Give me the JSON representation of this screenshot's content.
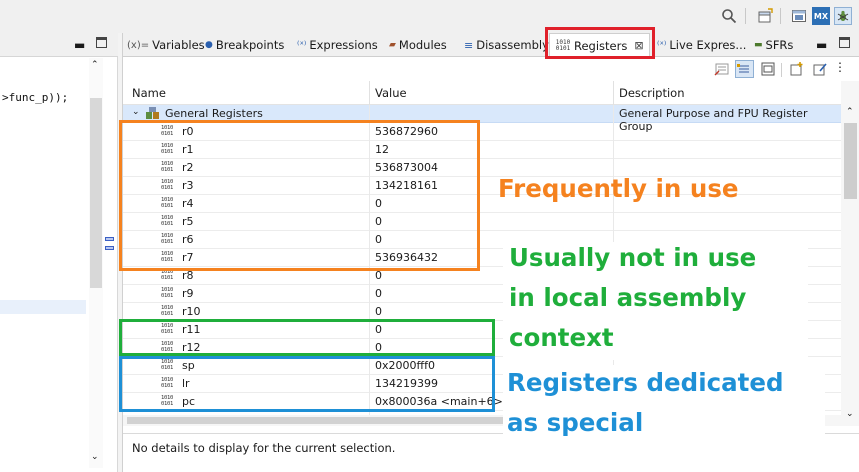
{
  "toolbar": {
    "search_icon": "search-icon",
    "icons": [
      "search-icon",
      "perspective-icon",
      "debug-perspective-icon",
      "mx-icon",
      "debug-icon"
    ],
    "mx_label": "MX"
  },
  "editor": {
    "code_line": ">func_p));"
  },
  "view_tabs": [
    {
      "label": "Variables",
      "icon": "(x)="
    },
    {
      "label": "Breakpoints",
      "icon": "●"
    },
    {
      "label": "Expressions",
      "icon": "⁽ˣ⁾"
    },
    {
      "label": "Modules",
      "icon": "▰"
    },
    {
      "label": "Disassembly",
      "icon": "≡"
    },
    {
      "label": "Registers",
      "icon": "1010"
    },
    {
      "label": "Live Expres...",
      "icon": "⁽ˣ⁾"
    },
    {
      "label": "SFRs",
      "icon": "▬"
    }
  ],
  "columns": {
    "name": "Name",
    "value": "Value",
    "description": "Description"
  },
  "group": {
    "name": "General Registers",
    "description": "General Purpose and FPU Register Group"
  },
  "registers": [
    {
      "name": "r0",
      "value": "536872960"
    },
    {
      "name": "r1",
      "value": "12"
    },
    {
      "name": "r2",
      "value": "536873004"
    },
    {
      "name": "r3",
      "value": "134218161"
    },
    {
      "name": "r4",
      "value": "0"
    },
    {
      "name": "r5",
      "value": "0"
    },
    {
      "name": "r6",
      "value": "0"
    },
    {
      "name": "r7",
      "value": "536936432"
    },
    {
      "name": "r8",
      "value": "0"
    },
    {
      "name": "r9",
      "value": "0"
    },
    {
      "name": "r10",
      "value": "0"
    },
    {
      "name": "r11",
      "value": "0"
    },
    {
      "name": "r12",
      "value": "0"
    },
    {
      "name": "sp",
      "value": "0x2000fff0"
    },
    {
      "name": "lr",
      "value": "134219399"
    },
    {
      "name": "pc",
      "value": "0x800036a <main+6>"
    }
  ],
  "register_icon_bits": [
    "1010",
    "0101"
  ],
  "details_text": "No details to display for the current selection.",
  "annotations": {
    "frequent": {
      "text": "Frequently in use",
      "color": "#f5821f"
    },
    "unused_line1": {
      "text": "Usually not in use",
      "color": "#1fae3b"
    },
    "unused_line2": {
      "text": "in local assembly",
      "color": "#1fae3b"
    },
    "unused_line3": {
      "text": "context",
      "color": "#1fae3b"
    },
    "special_line1": {
      "text": "Registers dedicated",
      "color": "#1e90d6"
    },
    "special_line2": {
      "text": "as special",
      "color": "#1e90d6"
    },
    "registers_tab_highlight_color": "#e0202a"
  },
  "colors": {
    "row_selected": "#d9e8fb",
    "orange": "#f5821f",
    "green": "#1fae3b",
    "blue": "#1e90d6",
    "red": "#e0202a"
  }
}
